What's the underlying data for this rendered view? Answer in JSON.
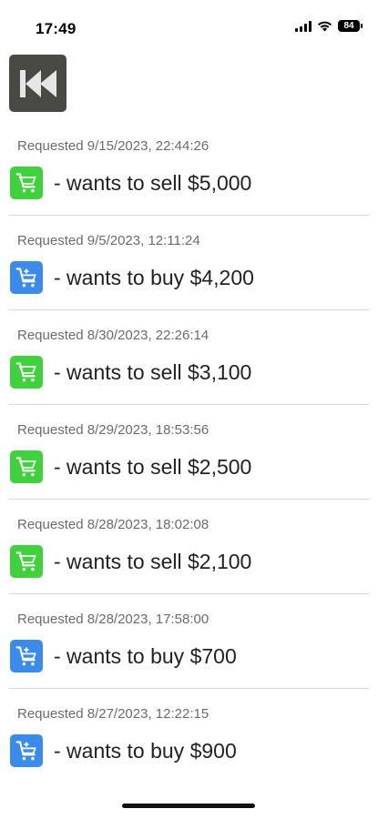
{
  "status_bar": {
    "time": "17:49",
    "battery": "84",
    "icons": [
      "signal-icon",
      "wifi-icon",
      "battery-icon"
    ]
  },
  "toolbar": {
    "back_icon": "skip-back-icon"
  },
  "requests": [
    {
      "date": "Requested 9/15/2023, 22:44:26",
      "type": "sell",
      "icon": "cart-sell-icon",
      "text": "- wants to sell $5,000"
    },
    {
      "date": "Requested 9/5/2023, 12:11:24",
      "type": "buy",
      "icon": "cart-buy-icon",
      "text": "- wants to buy $4,200"
    },
    {
      "date": "Requested 8/30/2023, 22:26:14",
      "type": "sell",
      "icon": "cart-sell-icon",
      "text": "- wants to sell $3,100"
    },
    {
      "date": "Requested 8/29/2023, 18:53:56",
      "type": "sell",
      "icon": "cart-sell-icon",
      "text": "- wants to sell $2,500"
    },
    {
      "date": "Requested 8/28/2023, 18:02:08",
      "type": "sell",
      "icon": "cart-sell-icon",
      "text": "- wants to sell $2,100"
    },
    {
      "date": "Requested 8/28/2023, 17:58:00",
      "type": "buy",
      "icon": "cart-buy-icon",
      "text": "- wants to buy $700"
    },
    {
      "date": "Requested 8/27/2023, 12:22:15",
      "type": "buy",
      "icon": "cart-buy-icon",
      "text": "- wants to buy $900"
    }
  ],
  "colors": {
    "sell": "#3fd23d",
    "buy": "#3b8bea",
    "back_button": "#4a4a44"
  }
}
